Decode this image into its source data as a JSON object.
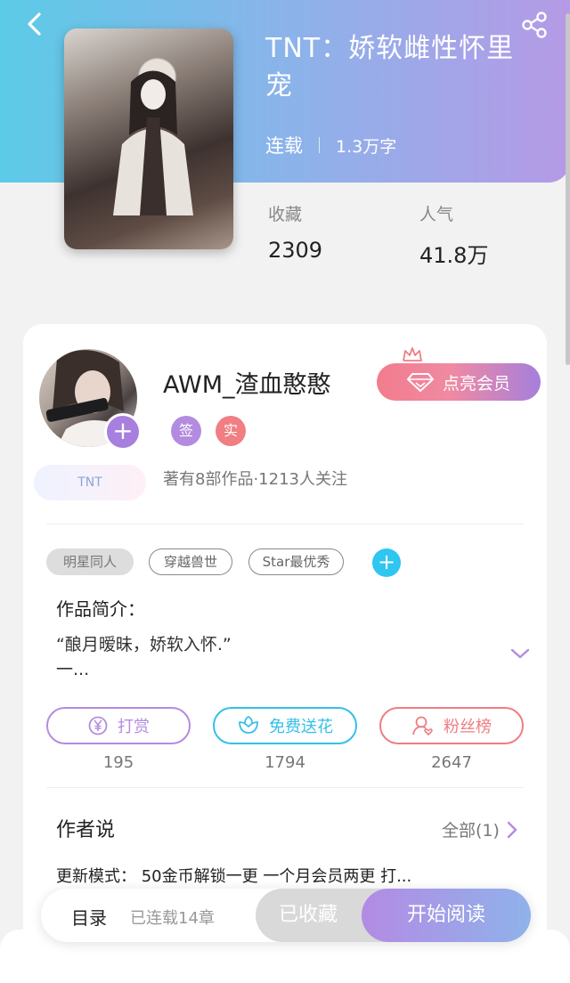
{
  "header": {
    "title": "TNT：娇软雌性怀里宠",
    "status": "连载",
    "word_count": "1.3万字",
    "gradient_colors": [
      "#5ccbe8",
      "#b59ae6"
    ],
    "icons": {
      "back": "back-chevron-icon",
      "share": "share-icon"
    }
  },
  "stats": [
    {
      "label": "收藏",
      "value": "2309"
    },
    {
      "label": "人气",
      "value": "41.8万"
    }
  ],
  "author": {
    "name": "AWM_渣血憨憨",
    "tags": [
      {
        "text": "签",
        "color": "#b38be0"
      },
      {
        "text": "实",
        "color": "#f07e83"
      }
    ],
    "info": "著有8部作品·1213人关注",
    "badge": "TNT",
    "vip_button": "点亮会员"
  },
  "genres": [
    "明星同人",
    "穿越兽世",
    "Star最优秀"
  ],
  "intro": {
    "heading": "作品简介：",
    "line1": "“酿月暧昧，娇软入怀.”",
    "line2": "一..."
  },
  "actions": [
    {
      "label": "打赏",
      "count": "195",
      "color": "#b48be0",
      "icon": "yen-coin-icon"
    },
    {
      "label": "免费送花",
      "count": "1794",
      "color": "#33c0e8",
      "icon": "flower-icon"
    },
    {
      "label": "粉丝榜",
      "count": "2647",
      "color": "#ef7d84",
      "icon": "fan-user-icon"
    }
  ],
  "author_says": {
    "heading": "作者说",
    "all": "全部(1)",
    "text": "更新模式：  50金币解锁一更 一个月会员两更 打..."
  },
  "bottom_bar": {
    "toc": "目录",
    "chapters": "已连载14章",
    "collected": "已收藏",
    "start_reading": "开始阅读"
  }
}
